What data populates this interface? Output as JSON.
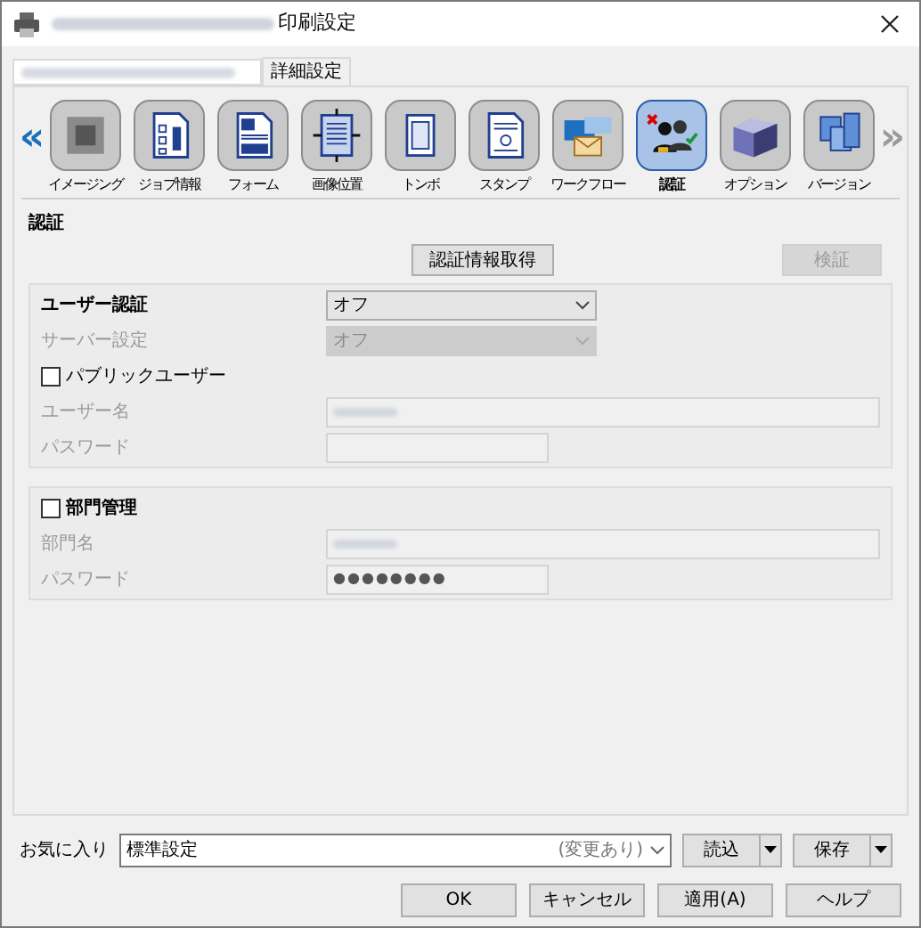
{
  "window": {
    "title": "印刷設定"
  },
  "tabs": [
    {
      "kind": "blurred",
      "selected": false
    },
    {
      "kind": "text",
      "label": "詳細設定",
      "selected": true
    }
  ],
  "nav": {
    "prev": "«",
    "next": "»",
    "prev_disabled": false,
    "next_disabled": true
  },
  "categories": [
    {
      "label": "イメージング",
      "selected": false
    },
    {
      "label": "ジョブ情報",
      "selected": false
    },
    {
      "label": "フォーム",
      "selected": false
    },
    {
      "label": "画像位置",
      "selected": false
    },
    {
      "label": "トンボ",
      "selected": false
    },
    {
      "label": "スタンプ",
      "selected": false
    },
    {
      "label": "ワークフロー",
      "selected": false
    },
    {
      "label": "認証",
      "selected": true
    },
    {
      "label": "オプション",
      "selected": false
    },
    {
      "label": "バージョン",
      "selected": false
    }
  ],
  "section": {
    "title": "認証",
    "buttons": [
      {
        "label": "認証情報取得",
        "disabled": false
      },
      {
        "label": "検証",
        "disabled": true
      }
    ]
  },
  "groups": [
    {
      "rows": [
        {
          "kind": "select",
          "label": "ユーザー認証",
          "value": "オフ",
          "disabled": false
        },
        {
          "kind": "select",
          "label": "サーバー設定",
          "value": "オフ",
          "disabled": true
        },
        {
          "kind": "checkbox",
          "label": "パブリックユーザー",
          "checked": false,
          "disabled": false
        },
        {
          "kind": "text",
          "label": "ユーザー名",
          "blurred": true,
          "wide": true,
          "disabled": true
        },
        {
          "kind": "text",
          "label": "パスワード",
          "wide": false,
          "disabled": true
        }
      ]
    },
    {
      "rows": [
        {
          "kind": "checkbox",
          "label": "部門管理",
          "checked": false,
          "disabled": false
        },
        {
          "kind": "text",
          "label": "部門名",
          "blurred": true,
          "wide": true,
          "disabled": true
        },
        {
          "kind": "text",
          "label": "パスワード",
          "value": "●●●●●●●●",
          "wide": false,
          "disabled": true
        }
      ]
    }
  ],
  "favorites": {
    "label": "お気に入り",
    "value": "標準設定",
    "note": "(変更あり)",
    "buttons": [
      "読込",
      "保存"
    ]
  },
  "buttons": [
    "OK",
    "キャンセル",
    "適用(A)",
    "ヘルプ"
  ]
}
